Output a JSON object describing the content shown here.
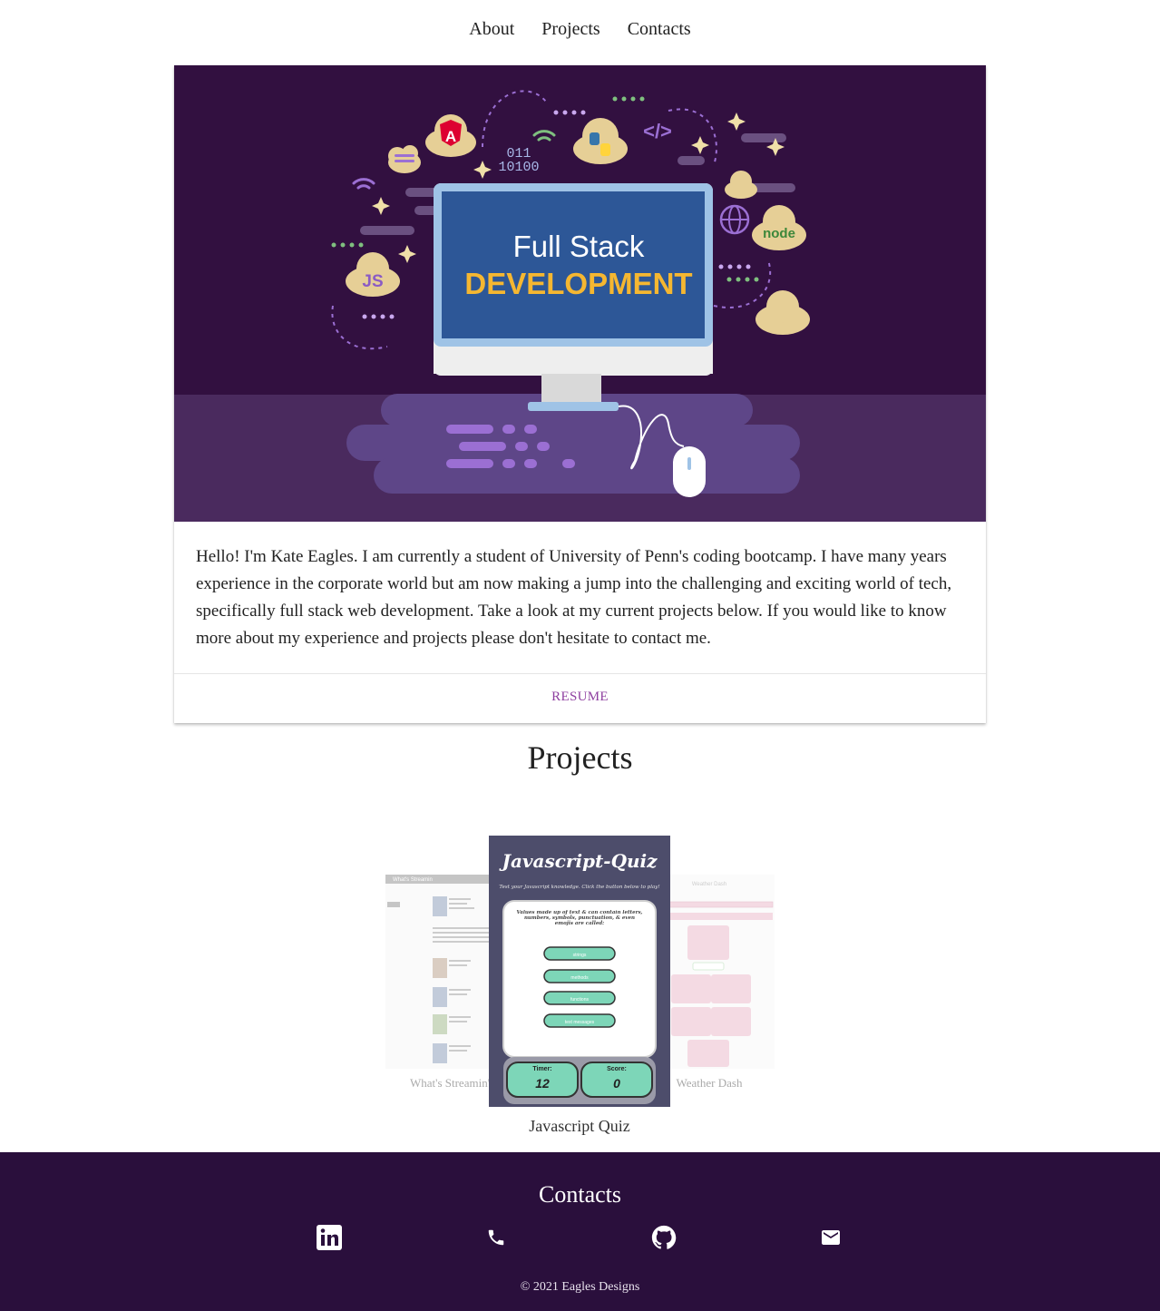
{
  "nav": {
    "about": "About",
    "projects": "Projects",
    "contacts": "Contacts"
  },
  "hero": {
    "line1": "Full Stack",
    "line2": "DEVELOPMENT",
    "binary1": "011",
    "binary2": "10100",
    "code_tag": "</>",
    "js": "JS",
    "node": "node"
  },
  "about": {
    "text": "Hello! I'm Kate Eagles. I am currently a student of University of Penn's coding bootcamp. I have many years experience in the corporate world but am now making a jump into the challenging and exciting world of tech, specifically full stack web development. Take a look at my current projects below. If you would like to know more about my experience and projects please don't hesitate to contact me.",
    "resume_label": "RESUME"
  },
  "projects": {
    "heading": "Projects",
    "items": [
      {
        "label": "What's Streamin'",
        "screen_title": "What's Streamin"
      },
      {
        "label": "Javascript Quiz",
        "screen_title": "Javascript-Quiz",
        "subtitle": "Test your Javascript knowledge. Click the button below to play!",
        "question": "Values made up of text & can contain letters, numbers, symbols, punctuation, & even emojis are called:",
        "answers": [
          "strings",
          "methods",
          "functions",
          "text messages"
        ],
        "timer_label": "Timer:",
        "timer_value": "12",
        "score_label": "Score:",
        "score_value": "0"
      },
      {
        "label": "Weather Dash",
        "screen_title": "Weather Dash"
      }
    ]
  },
  "footer": {
    "title": "Contacts",
    "icons": [
      "linkedin-icon",
      "phone-icon",
      "github-icon",
      "email-icon"
    ],
    "copyright": "© 2021 Eagles Designs"
  },
  "colors": {
    "footer_bg": "#2a0f3c",
    "hero_bg": "#321040",
    "accent": "#8e3fa0"
  }
}
